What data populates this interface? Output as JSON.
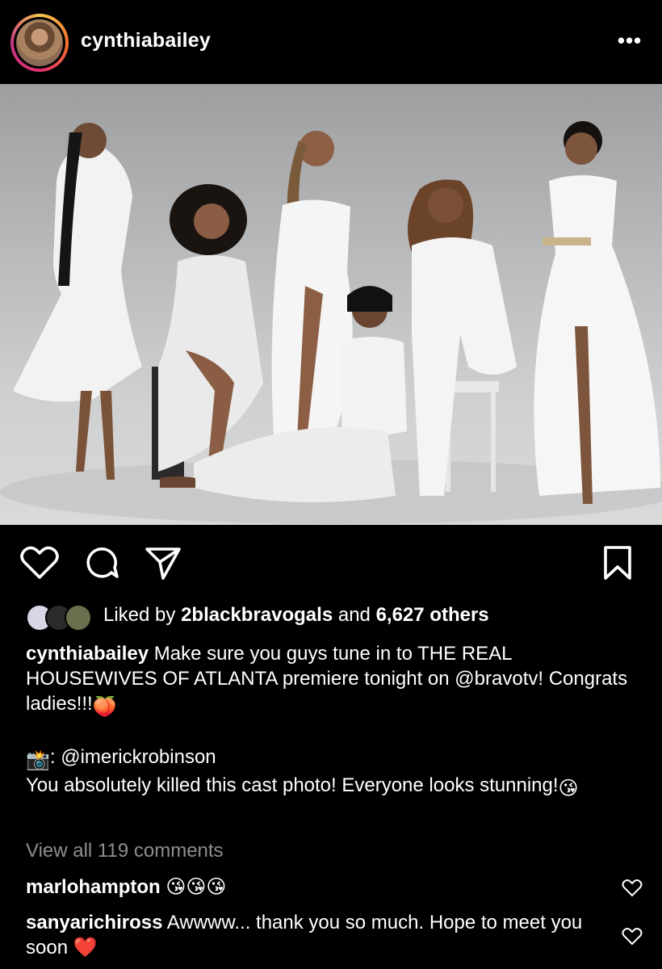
{
  "header": {
    "username": "cynthiabailey",
    "more_label": "•••",
    "avatar_icon": "profile-avatar-icon"
  },
  "post": {
    "photo_description_icon": "group-photo-image",
    "background_color": "#c8c9ca"
  },
  "actions": {
    "like_icon": "heart-icon",
    "comment_icon": "comment-icon",
    "share_icon": "send-icon",
    "save_icon": "bookmark-icon"
  },
  "likes": {
    "prefix": "Liked by",
    "user": "2blackbravogals",
    "middle": "and",
    "others": "6,627 others"
  },
  "caption": {
    "username": "cynthiabailey",
    "text": " Make sure you guys tune in to THE REAL HOUSEWIVES OF ATLANTA premiere tonight on @bravotv! Congrats ladies!!!",
    "emoji1": "🍑",
    "credit": ": @imerickrobinson",
    "camera_emoji": "📸",
    "line2": "You absolutely killed this cast photo! Everyone looks stunning!",
    "emoji2": "😘"
  },
  "view_all": "View all 119 comments",
  "comments": [
    {
      "username": "marlohampton",
      "text": " 😘😘😘"
    },
    {
      "username": "sanyarichiross",
      "text": " Awwww... thank you so much. Hope to meet you soon ❤️"
    }
  ],
  "colors": {
    "background": "#000000",
    "text": "#ffffff",
    "muted": "#8e8e8e"
  }
}
